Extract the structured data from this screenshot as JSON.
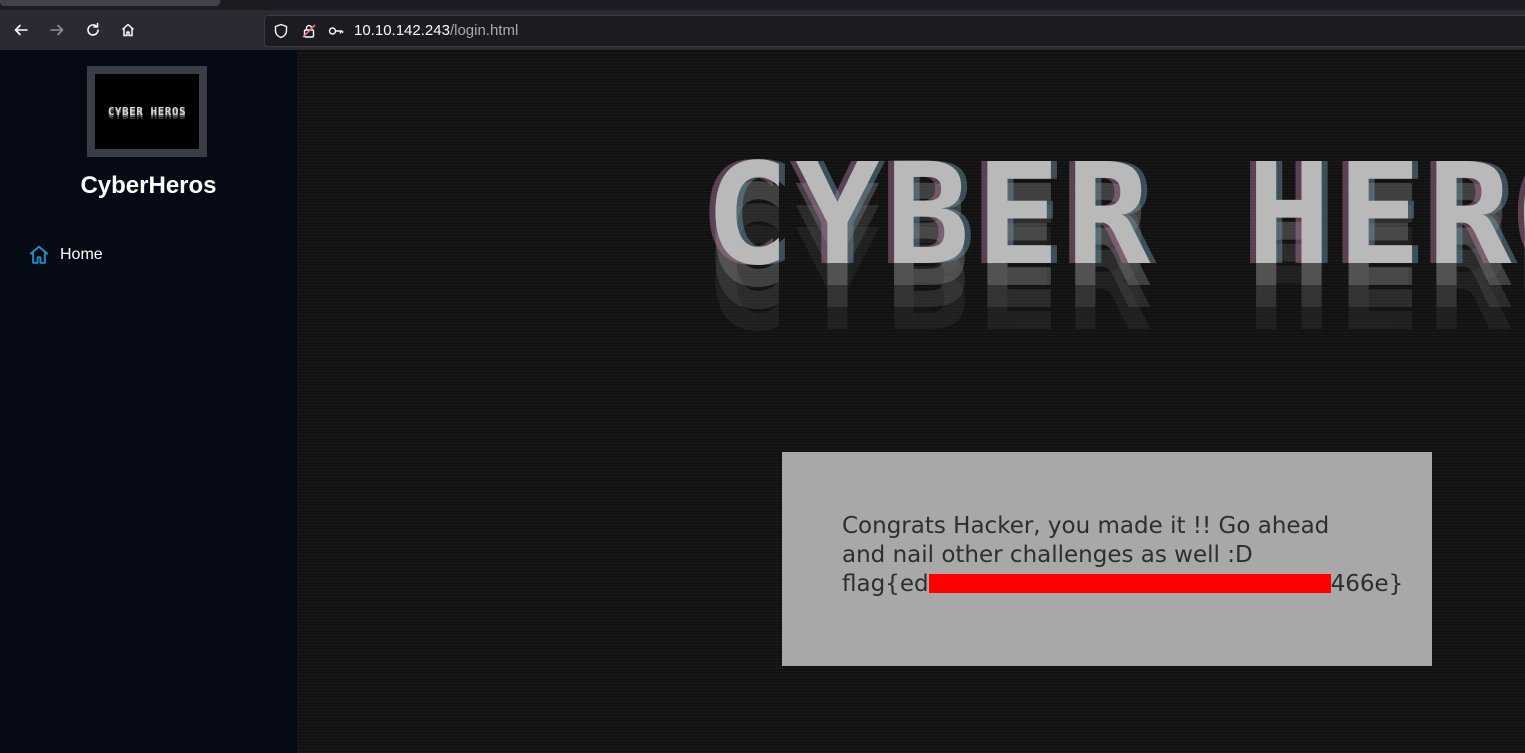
{
  "browser": {
    "url_host": "10.10.142.243",
    "url_path": "/login.html",
    "icons": [
      "back-icon",
      "forward-icon",
      "reload-icon",
      "home-icon",
      "shield-icon",
      "insecure-lock-icon",
      "key-icon"
    ]
  },
  "sidebar": {
    "logo_text": "CYBER HEROS",
    "site_name": "CyberHeros",
    "nav": [
      {
        "label": "Home",
        "icon": "home-icon"
      }
    ],
    "accent_color": "#1e90c8"
  },
  "main": {
    "banner_text": "CYBER HEROS",
    "message": {
      "line1": "Congrats Hacker, you made it !! Go ahead",
      "line2": "and nail other challenges as well :D",
      "flag_prefix": "flag{ed",
      "flag_suffix": "466e}",
      "redaction_color": "#ff0000"
    },
    "box_color": "#a8a8a8"
  }
}
